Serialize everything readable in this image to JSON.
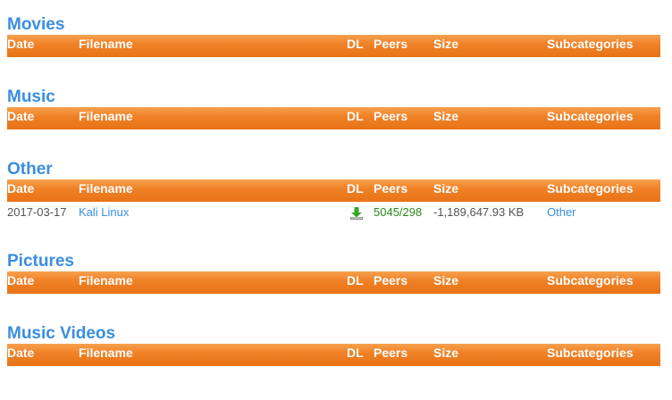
{
  "columns": {
    "date": "Date",
    "filename": "Filename",
    "dl": "DL",
    "peers": "Peers",
    "size": "Size",
    "subcategories": "Subcategories"
  },
  "sections": [
    {
      "title": "Movies",
      "rows": []
    },
    {
      "title": "Music",
      "rows": []
    },
    {
      "title": "Other",
      "rows": [
        {
          "date": "2017-03-17",
          "filename": "Kali Linux",
          "dl_icon": "download-arrow-icon",
          "peers": "5045/298",
          "size": "-1,189,647.93 KB",
          "subcategory": "Other"
        }
      ]
    },
    {
      "title": "Pictures",
      "rows": []
    },
    {
      "title": "Music Videos",
      "rows": []
    }
  ],
  "colors": {
    "heading": "#3a8ee0",
    "header_bg": "#f08228",
    "peers": "#2a8a1a",
    "link": "#3a8ee0"
  }
}
